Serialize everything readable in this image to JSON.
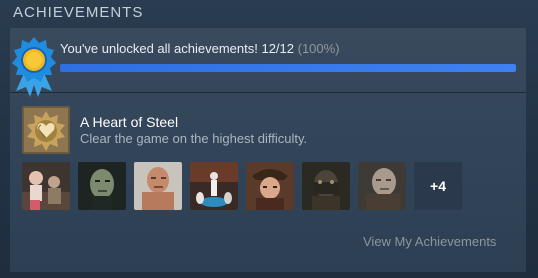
{
  "header": {
    "title": "ACHIEVEMENTS"
  },
  "progress": {
    "text": "You've unlocked all achievements! 12/12",
    "percent_label": "(100%)",
    "unlocked": 12,
    "total": 12,
    "fraction": 1.0
  },
  "featured": {
    "title": "A Heart of Steel",
    "description": "Clear the game on the highest difficulty."
  },
  "achievement_icons": [
    {
      "name": "achievement-icon-1"
    },
    {
      "name": "achievement-icon-2"
    },
    {
      "name": "achievement-icon-3"
    },
    {
      "name": "achievement-icon-4"
    },
    {
      "name": "achievement-icon-5"
    },
    {
      "name": "achievement-icon-6"
    },
    {
      "name": "achievement-icon-7"
    }
  ],
  "more_label": "+4",
  "view_link": "View My Achievements",
  "colors": {
    "accent": "#3d82f0",
    "background": "#2a3c50"
  }
}
